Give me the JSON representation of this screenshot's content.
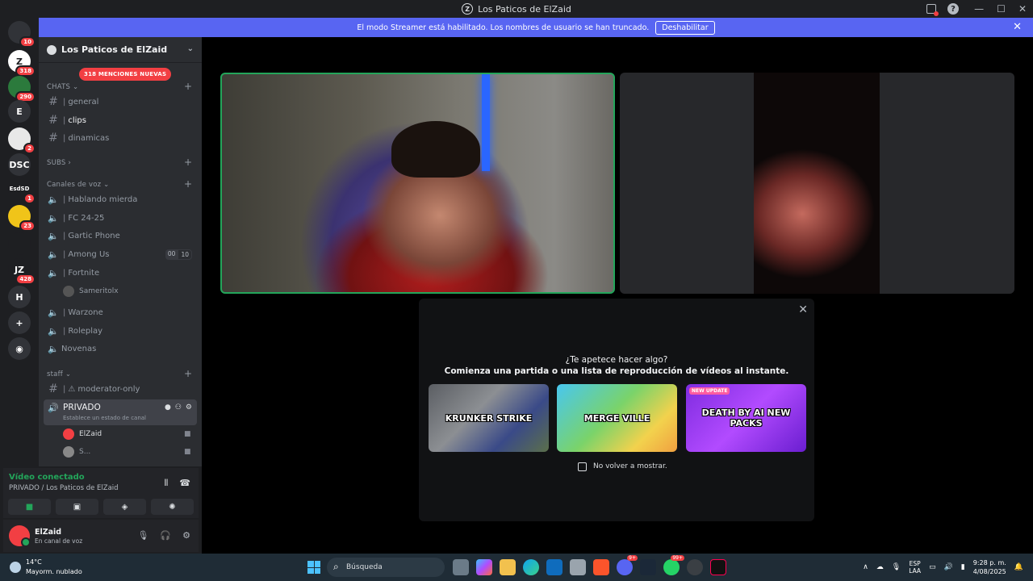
{
  "window": {
    "title": "Los Paticos de ElZaid"
  },
  "banner": {
    "text": "El modo Streamer está habilitado. Los nombres de usuario se han truncado.",
    "button": "Deshabilitar"
  },
  "guilds": [
    {
      "label": "",
      "badge": "10",
      "color": "#313338"
    },
    {
      "label": "Z",
      "badge": "318",
      "color": "#ffffff"
    },
    {
      "label": "",
      "badge": "290",
      "color": "#2b7a3c"
    },
    {
      "label": "E",
      "badge": "",
      "color": "#313338"
    },
    {
      "label": "",
      "badge": "2",
      "color": "#e8e8e8"
    },
    {
      "label": "DSC",
      "badge": "",
      "color": "#313338"
    },
    {
      "label": "EsdSD",
      "badge": "1",
      "color": "#1e1f22"
    },
    {
      "label": "",
      "badge": "23",
      "color": "#f0c419"
    },
    {
      "label": "",
      "badge": "",
      "color": "#1e1f22"
    },
    {
      "label": "JZ",
      "badge": "428",
      "color": "#1e1f22"
    },
    {
      "label": "H",
      "badge": "",
      "color": "#313338"
    },
    {
      "label": "+",
      "badge": "",
      "color": "#313338"
    },
    {
      "label": "◉",
      "badge": "",
      "color": "#313338"
    }
  ],
  "server": {
    "name": "Los Paticos de ElZaid",
    "mentions": "318 MENCIONES NUEVAS",
    "categories": {
      "chats": "CHATS",
      "subs": "SUBS",
      "voice": "Canales de voz",
      "staff": "staff"
    },
    "text_channels": [
      {
        "name": "general"
      },
      {
        "name": "clips"
      },
      {
        "name": "dinamicas"
      }
    ],
    "voice_channels": [
      {
        "name": "Hablando mierda"
      },
      {
        "name": "FC 24-25"
      },
      {
        "name": "Gartic Phone"
      },
      {
        "name": "Among Us",
        "count_a": "00",
        "count_b": "10"
      },
      {
        "name": "Fortnite"
      },
      {
        "name": "Warzone"
      },
      {
        "name": "Roleplay"
      },
      {
        "name": "Novenas"
      }
    ],
    "fortnite_member": "Sameritolx",
    "staff_channel": "moderator-only",
    "private_channel": {
      "name": "PRIVADO",
      "status": "Establece un estado de canal"
    },
    "private_members": [
      {
        "name": "ElZaid",
        "color": "#f23f43"
      },
      {
        "name": "S...",
        "color": "#888888"
      }
    ]
  },
  "voice_panel": {
    "status": "Vídeo conectado",
    "location": "PRIVADO / Los Paticos de ElZaid"
  },
  "user": {
    "name": "ElZaid",
    "status": "En canal de voz"
  },
  "activity": {
    "question": "¿Te apetece hacer algo?",
    "description": "Comienza una partida o una lista de reproducción de vídeos al instante.",
    "games": [
      {
        "name": "KRUNKER STRIKE",
        "tag": ""
      },
      {
        "name": "MERGE VILLE",
        "tag": ""
      },
      {
        "name": "DEATH BY AI NEW PACKS",
        "tag": "NEW UPDATE"
      }
    ],
    "dont_show": "No volver a mostrar."
  },
  "taskbar": {
    "temp": "14°C",
    "weather": "Mayorm. nublado",
    "search": "Búsqueda",
    "app_badge_1": "9+",
    "app_badge_2": "99+",
    "lang_1": "ESP",
    "lang_2": "LAA",
    "time": "9:28 p. m.",
    "date": "4/08/2025"
  }
}
